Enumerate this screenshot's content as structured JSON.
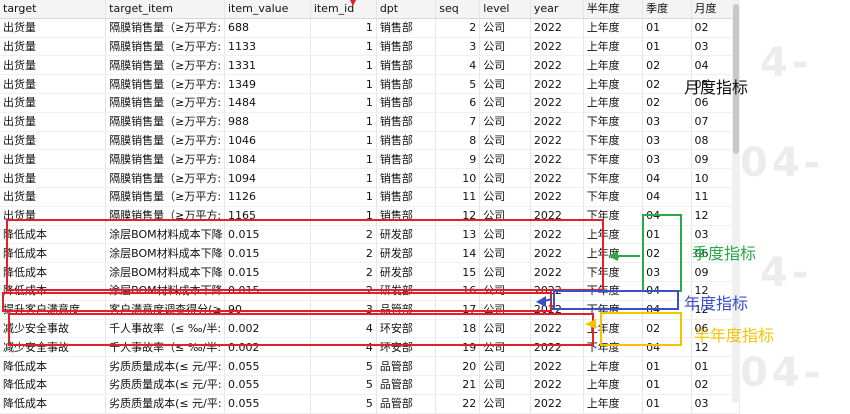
{
  "columns": [
    "target",
    "target_item",
    "item_value",
    "item_id",
    "dpt",
    "seq",
    "level",
    "year",
    "半年度",
    "季度",
    "月度"
  ],
  "rows": [
    [
      "出货量",
      "隔膜销售量（≥万平方:",
      "688",
      "1",
      "销售部",
      "2",
      "公司",
      "2022",
      "上年度",
      "01",
      "02"
    ],
    [
      "出货量",
      "隔膜销售量（≥万平方:",
      "1133",
      "1",
      "销售部",
      "3",
      "公司",
      "2022",
      "上年度",
      "01",
      "03"
    ],
    [
      "出货量",
      "隔膜销售量（≥万平方:",
      "1331",
      "1",
      "销售部",
      "4",
      "公司",
      "2022",
      "上年度",
      "02",
      "04"
    ],
    [
      "出货量",
      "隔膜销售量（≥万平方:",
      "1349",
      "1",
      "销售部",
      "5",
      "公司",
      "2022",
      "上年度",
      "02",
      "05"
    ],
    [
      "出货量",
      "隔膜销售量（≥万平方:",
      "1484",
      "1",
      "销售部",
      "6",
      "公司",
      "2022",
      "上年度",
      "02",
      "06"
    ],
    [
      "出货量",
      "隔膜销售量（≥万平方:",
      "988",
      "1",
      "销售部",
      "7",
      "公司",
      "2022",
      "下年度",
      "03",
      "07"
    ],
    [
      "出货量",
      "隔膜销售量（≥万平方:",
      "1046",
      "1",
      "销售部",
      "8",
      "公司",
      "2022",
      "下年度",
      "03",
      "08"
    ],
    [
      "出货量",
      "隔膜销售量（≥万平方:",
      "1084",
      "1",
      "销售部",
      "9",
      "公司",
      "2022",
      "下年度",
      "03",
      "09"
    ],
    [
      "出货量",
      "隔膜销售量（≥万平方:",
      "1094",
      "1",
      "销售部",
      "10",
      "公司",
      "2022",
      "下年度",
      "04",
      "10"
    ],
    [
      "出货量",
      "隔膜销售量（≥万平方:",
      "1126",
      "1",
      "销售部",
      "11",
      "公司",
      "2022",
      "下年度",
      "04",
      "11"
    ],
    [
      "出货量",
      "隔膜销售量（≥万平方:",
      "1165",
      "1",
      "销售部",
      "12",
      "公司",
      "2022",
      "下年度",
      "04",
      "12"
    ],
    [
      "降低成本",
      "涂层BOM材料成本下降",
      "0.015",
      "2",
      "研发部",
      "13",
      "公司",
      "2022",
      "上年度",
      "01",
      "03"
    ],
    [
      "降低成本",
      "涂层BOM材料成本下降",
      "0.015",
      "2",
      "研发部",
      "14",
      "公司",
      "2022",
      "上年度",
      "02",
      "06"
    ],
    [
      "降低成本",
      "涂层BOM材料成本下降",
      "0.015",
      "2",
      "研发部",
      "15",
      "公司",
      "2022",
      "下年度",
      "03",
      "09"
    ],
    [
      "降低成本",
      "涂层BOM材料成本下降",
      "0.015",
      "2",
      "研发部",
      "16",
      "公司",
      "2022",
      "下年度",
      "04",
      "12"
    ],
    [
      "提升客户满意度",
      "客户满意度调查得分(≥",
      "90",
      "3",
      "品管部",
      "17",
      "公司",
      "2022",
      "下年度",
      "04",
      "12"
    ],
    [
      "减少安全事故",
      "千人事故率（≤ ‰/半:",
      "0.002",
      "4",
      "环安部",
      "18",
      "公司",
      "2022",
      "上年度",
      "02",
      "06"
    ],
    [
      "减少安全事故",
      "千人事故率（≤ ‰/半:",
      "0.002",
      "4",
      "环安部",
      "19",
      "公司",
      "2022",
      "下年度",
      "04",
      "12"
    ],
    [
      "降低成本",
      "劣质质量成本(≤ 元/平:",
      "0.055",
      "5",
      "品管部",
      "20",
      "公司",
      "2022",
      "上年度",
      "01",
      "01"
    ],
    [
      "降低成本",
      "劣质质量成本(≤ 元/平:",
      "0.055",
      "5",
      "品管部",
      "21",
      "公司",
      "2022",
      "上年度",
      "01",
      "02"
    ],
    [
      "降低成本",
      "劣质质量成本(≤ 元/平:",
      "0.055",
      "5",
      "品管部",
      "22",
      "公司",
      "2022",
      "上年度",
      "01",
      "03"
    ]
  ],
  "annotations": {
    "monthly": "月度指标",
    "quarterly": "季度指标",
    "annual": "年度指标",
    "half_year": "半年度指标"
  },
  "colors": {
    "red": "#e0202a",
    "green": "#2aa84a",
    "blue": "#3a4fc8",
    "yellow": "#f5c400"
  }
}
